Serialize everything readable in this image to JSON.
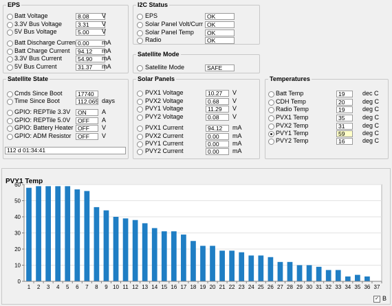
{
  "eps": {
    "title": "EPS",
    "rows": [
      {
        "label": "Batt Voltage",
        "value": "8.08",
        "unit": "V"
      },
      {
        "label": "3.3V Bus Voltage",
        "value": "3.31",
        "unit": "V"
      },
      {
        "label": "5V Bus Voltage",
        "value": "5.00",
        "unit": "V"
      },
      {
        "label": "Batt Discharge Current",
        "value": "0.00",
        "unit": "mA"
      },
      {
        "label": "Batt Charge Current",
        "value": "94.12",
        "unit": "mA"
      },
      {
        "label": "3.3V Bus Current",
        "value": "54.90",
        "unit": "mA"
      },
      {
        "label": "5V Bus Current",
        "value": "31.37",
        "unit": "mA"
      }
    ]
  },
  "i2c": {
    "title": "I2C Status",
    "rows": [
      {
        "label": "EPS",
        "value": "OK"
      },
      {
        "label": "Solar Panel Volt/Curr",
        "value": "OK"
      },
      {
        "label": "Solar Panel Temp",
        "value": "OK"
      },
      {
        "label": "Radio",
        "value": "OK"
      }
    ]
  },
  "mode": {
    "title": "Satellite Mode",
    "row": {
      "label": "Satellite Mode",
      "value": "SAFE"
    }
  },
  "state": {
    "title": "Satellite State",
    "rows": [
      {
        "label": "Cmds Since Boot",
        "value": "17740",
        "unit": ""
      },
      {
        "label": "Time Since Boot",
        "value": "112.0658",
        "unit": "days"
      },
      {
        "label": "GPIO: REPTile 3.3V",
        "value": "ON",
        "unit": "A"
      },
      {
        "label": "GPIO: REPTile 5.0V",
        "value": "OFF",
        "unit": "A"
      },
      {
        "label": "GPIO: Battery Heater",
        "value": "OFF",
        "unit": "V"
      },
      {
        "label": "GPIO: ADM Resistor",
        "value": "OFF",
        "unit": "V"
      }
    ],
    "status": "112 d 01:34:41"
  },
  "solar": {
    "title": "Solar Panels",
    "rows": [
      {
        "label": "PVX1 Voltage",
        "value": "10.27",
        "unit": "V"
      },
      {
        "label": "PVX2 Voltage",
        "value": "0.68",
        "unit": "V"
      },
      {
        "label": "PVY1 Voltage",
        "value": "11.29",
        "unit": "V"
      },
      {
        "label": "PVY2 Voltage",
        "value": "0.08",
        "unit": "V"
      },
      {
        "label": "PVX1 Current",
        "value": "94.12",
        "unit": "mA"
      },
      {
        "label": "PVX2 Current",
        "value": "0.00",
        "unit": "mA"
      },
      {
        "label": "PVY1 Current",
        "value": "0.00",
        "unit": "mA"
      },
      {
        "label": "PVY2 Current",
        "value": "0.00",
        "unit": "mA"
      }
    ]
  },
  "temps": {
    "title": "Temperatures",
    "selected_index": 5,
    "rows": [
      {
        "label": "Batt Temp",
        "value": "19",
        "unit": "dec C"
      },
      {
        "label": "CDH Temp",
        "value": "20",
        "unit": "deg C"
      },
      {
        "label": "Radio Temp",
        "value": "19",
        "unit": "deg C"
      },
      {
        "label": "PVX1 Temp",
        "value": "35",
        "unit": "deg C"
      },
      {
        "label": "PVX2 Temp",
        "value": "31",
        "unit": "deg C"
      },
      {
        "label": "PVY1 Temp",
        "value": "59",
        "unit": "deg C"
      },
      {
        "label": "PVY2 Temp",
        "value": "16",
        "unit": "deg C"
      }
    ]
  },
  "chart_title": "PVY1 Temp",
  "checkbox": {
    "label": "B",
    "checked": true,
    "mark": "✓"
  },
  "chart_data": {
    "type": "bar",
    "title": "PVY1 Temp",
    "categories": [
      "1",
      "2",
      "3",
      "4",
      "5",
      "6",
      "7",
      "8",
      "9",
      "10",
      "11",
      "12",
      "13",
      "14",
      "15",
      "16",
      "17",
      "18",
      "19",
      "20",
      "21",
      "22",
      "23",
      "24",
      "25",
      "26",
      "27",
      "28",
      "29",
      "30",
      "31",
      "32",
      "33",
      "34",
      "35",
      "36",
      "37"
    ],
    "values": [
      58,
      59,
      59,
      59,
      59,
      57,
      56,
      46,
      44,
      40,
      39,
      38,
      36,
      33,
      31,
      31,
      29,
      25,
      22,
      22,
      19,
      19,
      18,
      16,
      16,
      15,
      12,
      12,
      10,
      10,
      9,
      7,
      7,
      3,
      4,
      3,
      0
    ],
    "yticks": [
      0,
      10,
      20,
      30,
      40,
      50,
      60
    ],
    "ylim": [
      0,
      60
    ],
    "grid": true,
    "bar_color": "#1f7ec4",
    "xlabel": "",
    "ylabel": ""
  }
}
